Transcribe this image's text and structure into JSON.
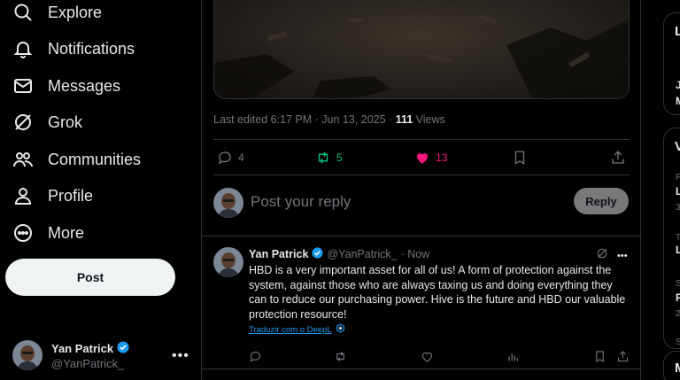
{
  "nav": {
    "explore": "Explore",
    "notifications": "Notifications",
    "messages": "Messages",
    "grok": "Grok",
    "communities": "Communities",
    "profile": "Profile",
    "more": "More"
  },
  "post_button": "Post",
  "account": {
    "name": "Yan Patrick",
    "handle": "@YanPatrick_",
    "more_glyph": "•••"
  },
  "main_post": {
    "edited": "Last edited 6:17 PM · Jun 13, 2025 · ",
    "views_count": "111",
    "views_label": "Views",
    "replies": "4",
    "reposts": "5",
    "likes": "13"
  },
  "reply": {
    "placeholder": "Post your reply",
    "button": "Reply"
  },
  "tweet": {
    "name": "Yan Patrick",
    "handle": "@YanPatrick_",
    "time": "· Now",
    "more_glyph": "•••",
    "text": "HBD is a very important asset for all of us! A form of protection against the system, against those who are always taxing us and doing everything they can to reduce our purchasing power. Hive is the future and HBD our valuable protection resource!",
    "translate": "Traduzir com o DeepL"
  },
  "right_rail": {
    "card1_title": "L",
    "card1_line1": "J",
    "card1_line2": "M",
    "card2_title": "V",
    "card2_s1": "P",
    "card2_b1": "L",
    "card2_s2": "3",
    "card2_s3": "T",
    "card2_b2": "L",
    "card2_s4": "S",
    "card2_b3": "P",
    "card2_s5": "2",
    "card2_s6": "S",
    "card3_title": "M"
  },
  "colors": {
    "accent": "#1d9bf0",
    "repost": "#00ba7c",
    "like": "#f91880",
    "muted": "#71767b",
    "text": "#e7e9ea"
  }
}
